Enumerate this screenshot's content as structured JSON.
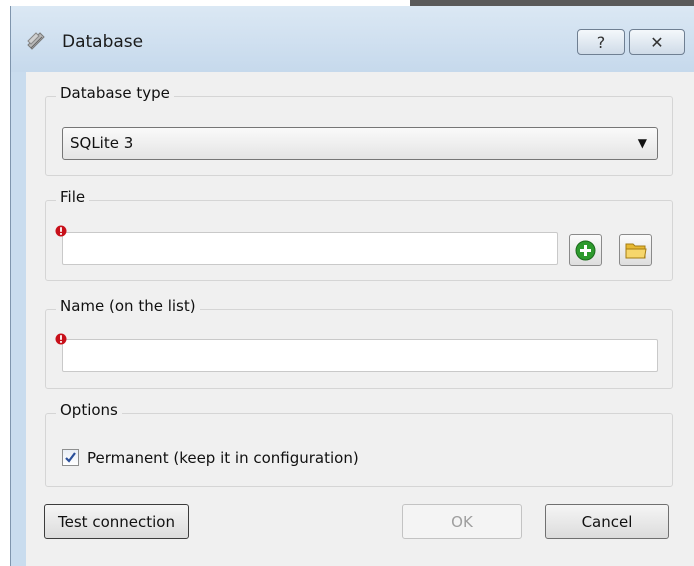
{
  "window": {
    "title": "Database",
    "help_symbol": "?",
    "close_symbol": "✕"
  },
  "database_type": {
    "label": "Database type",
    "selected": "SQLite 3",
    "arrow": "▼"
  },
  "file": {
    "label": "File",
    "value": "",
    "icons": [
      "error-icon",
      "add-icon",
      "folder-icon"
    ]
  },
  "name": {
    "label": "Name (on the list)",
    "value": ""
  },
  "options": {
    "label": "Options",
    "permanent_label": "Permanent (keep it in configuration)",
    "permanent_checked": true
  },
  "buttons": {
    "test_connection": "Test connection",
    "ok": "OK",
    "cancel": "Cancel"
  },
  "colors": {
    "title_bar": "#c9dcee",
    "dialog_bg": "#f0f0f0",
    "error": "#c8101a",
    "add": "#2e9a2e",
    "folder": "#f2c94a",
    "check": "#2a4f9a"
  }
}
